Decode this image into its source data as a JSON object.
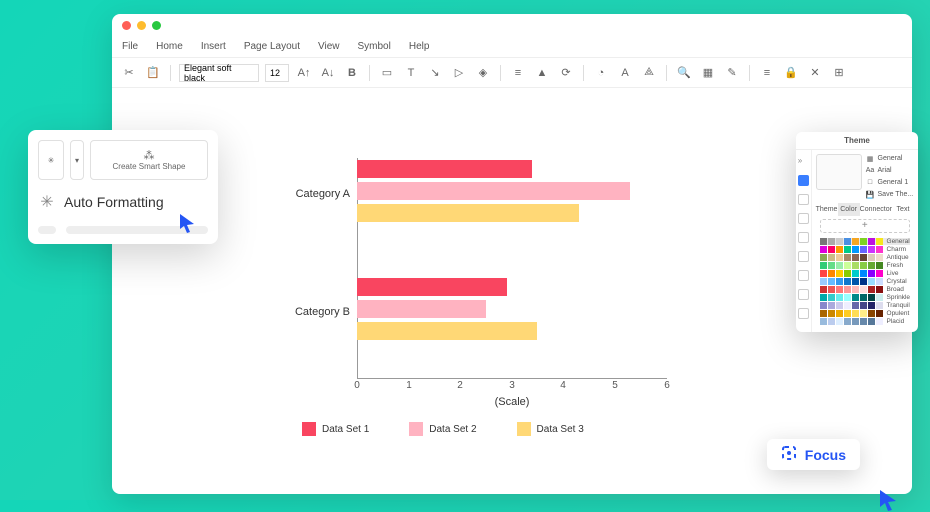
{
  "menus": [
    "File",
    "Home",
    "Insert",
    "Page Layout",
    "View",
    "Symbol",
    "Help"
  ],
  "toolbar": {
    "font": "Elegant soft black",
    "size": "12"
  },
  "popup": {
    "creator": "Create Smart Shape",
    "title": "Auto Formatting"
  },
  "theme": {
    "title": "Theme",
    "tabs": [
      "Theme",
      "Color",
      "Connector",
      "Text"
    ],
    "list": [
      "General",
      "Arial",
      "General 1",
      "Save The..."
    ],
    "swatches": [
      "General",
      "Charm",
      "Antique",
      "Fresh",
      "Live",
      "Crystal",
      "Broad",
      "Sprinkle",
      "Tranquil",
      "Opulent",
      "Placid"
    ]
  },
  "focus": "Focus",
  "legend": [
    "Data Set 1",
    "Data Set 2",
    "Data Set 3"
  ],
  "chart_data": {
    "type": "bar",
    "orientation": "horizontal",
    "categories": [
      "Category A",
      "Category B"
    ],
    "series": [
      {
        "name": "Data Set 1",
        "color": "#f94560",
        "values": [
          3.4,
          2.9
        ]
      },
      {
        "name": "Data Set 2",
        "color": "#ffb3c1",
        "values": [
          5.3,
          2.5
        ]
      },
      {
        "name": "Data Set 3",
        "color": "#ffd876",
        "values": [
          4.3,
          3.5
        ]
      }
    ],
    "xlabel": "(Scale)",
    "xlim": [
      0,
      6
    ],
    "xticks": [
      0,
      1,
      2,
      3,
      4,
      5,
      6
    ]
  }
}
